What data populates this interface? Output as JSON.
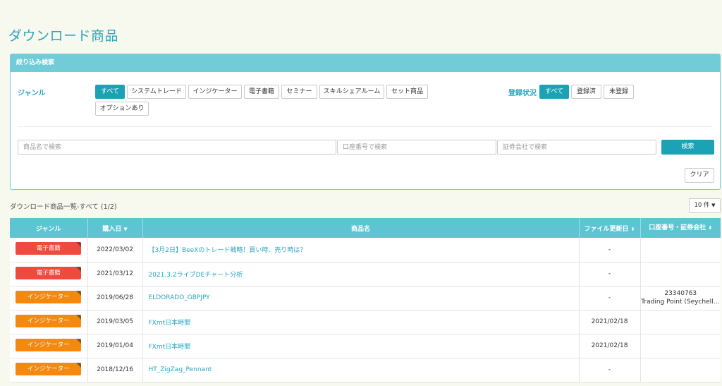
{
  "page": {
    "title": "ダウンロード商品"
  },
  "filter": {
    "header": "絞り込み検索",
    "genre_label": "ジャンル",
    "genres": [
      "すべて",
      "システムトレード",
      "インジケーター",
      "電子書籍",
      "セミナー",
      "スキルシェアルーム",
      "セット商品",
      "オプションあり"
    ],
    "status_label": "登録状況",
    "statuses": [
      "すべて",
      "登録済",
      "未登録"
    ],
    "search": {
      "product_placeholder": "商品名で検索",
      "account_placeholder": "口座番号で検索",
      "broker_placeholder": "証券会社で検索",
      "search_label": "検索",
      "clear_label": "クリア"
    }
  },
  "list": {
    "title": "ダウンロード商品一覧-すべて (1/2)",
    "page_size": "10 件",
    "columns": {
      "genre": "ジャンル",
      "purchase_date": "購入日",
      "product": "商品名",
      "updated": "ファイル更新日",
      "account": "口座番号・証券会社"
    },
    "rows": [
      {
        "genre": "電子書籍",
        "date": "2022/03/02",
        "name": "【3月2日】BeeXのトレード戦略！買い時、売り時は？",
        "updated": "-",
        "account": "",
        "broker": ""
      },
      {
        "genre": "電子書籍",
        "date": "2021/03/12",
        "name": "2021.3.2ライブDEチャート分析",
        "updated": "-",
        "account": "",
        "broker": ""
      },
      {
        "genre": "インジケーター",
        "date": "2019/06/28",
        "name": "ELDORADO_GBPJPY",
        "updated": "-",
        "account": "23340763",
        "broker": "Trading Point (Seychelles)"
      },
      {
        "genre": "インジケーター",
        "date": "2019/03/05",
        "name": "FXmt日本時間",
        "updated": "2021/02/18",
        "account": "",
        "broker": ""
      },
      {
        "genre": "インジケーター",
        "date": "2019/01/04",
        "name": "FXmt日本時間",
        "updated": "2021/02/18",
        "account": "",
        "broker": ""
      },
      {
        "genre": "インジケーター",
        "date": "2018/12/16",
        "name": "HT_ZigZag_Pennant",
        "updated": "-",
        "account": "",
        "broker": ""
      }
    ]
  },
  "colors": {
    "accent": "#1ba3b5",
    "header_bg": "#72ccd7",
    "badge_ebook": "#f04a3e",
    "badge_indicator": "#f5880d"
  }
}
